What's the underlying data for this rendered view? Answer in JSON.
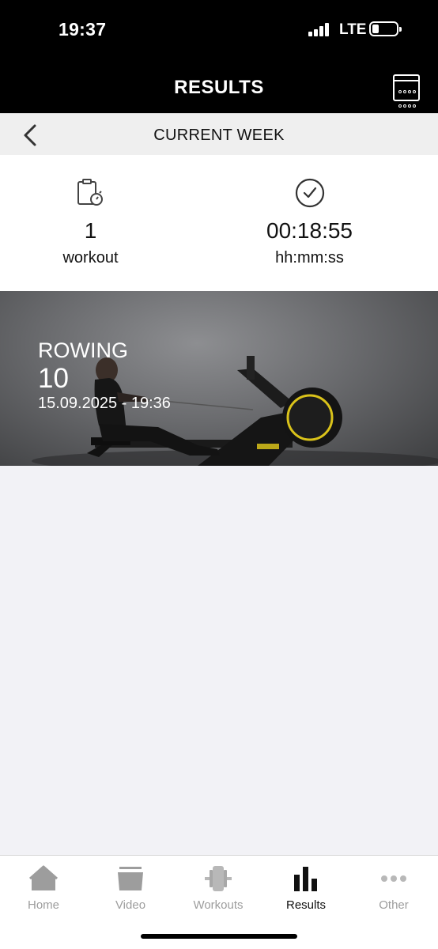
{
  "status_bar": {
    "time": "19:37",
    "network": "LTE"
  },
  "header": {
    "title": "RESULTS",
    "calendar_icon": "calendar-icon"
  },
  "week_bar": {
    "back_icon": "chevron-left-icon",
    "title": "CURRENT WEEK"
  },
  "stats": [
    {
      "icon": "clipboard-timer-icon",
      "value": "1",
      "unit": "workout"
    },
    {
      "icon": "clock-check-icon",
      "value": "00:18:55",
      "unit": "hh:mm:ss"
    }
  ],
  "workout_card": {
    "type": "ROWING",
    "value": "10",
    "date": "15.09.2025 - 19:36",
    "accent": "#d9c21a"
  },
  "tab_bar": {
    "items": [
      {
        "label": "Home",
        "icon": "home-icon",
        "active": false
      },
      {
        "label": "Video",
        "icon": "video-icon",
        "active": false
      },
      {
        "label": "Workouts",
        "icon": "barbell-icon",
        "active": false
      },
      {
        "label": "Results",
        "icon": "bar-chart-icon",
        "active": true
      },
      {
        "label": "Other",
        "icon": "more-dots-icon",
        "active": false
      }
    ]
  },
  "colors": {
    "active": "#111111",
    "inactive": "#9d9d9d",
    "background": "#f2f2f6"
  }
}
